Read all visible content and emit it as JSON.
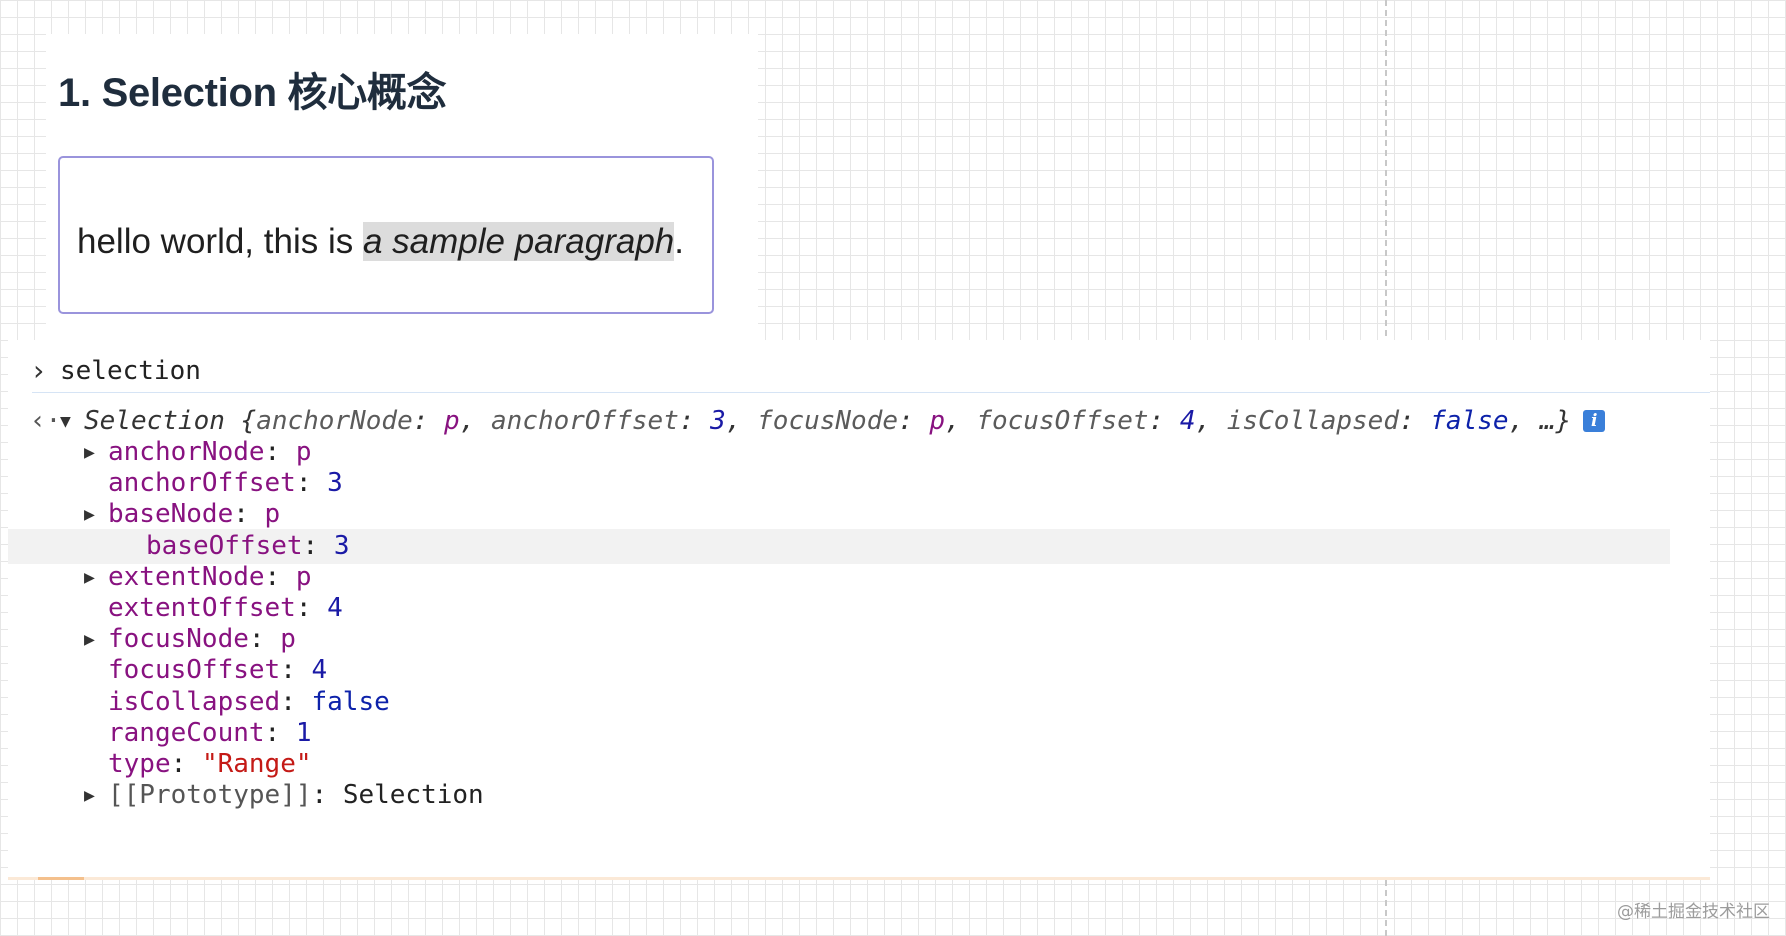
{
  "page": {
    "title": "1. Selection 核心概念",
    "paragraph": {
      "before": "hello world, this is ",
      "selected": "a sample paragraph",
      "after": "."
    }
  },
  "console": {
    "input": "selection",
    "summary": {
      "prefix": "Selection {",
      "anchorNode_key": "anchorNode",
      "anchorNode_val": "p",
      "anchorOffset_key": "anchorOffset",
      "anchorOffset_val": "3",
      "focusNode_key": "focusNode",
      "focusNode_val": "p",
      "focusOffset_key": "focusOffset",
      "focusOffset_val": "4",
      "isCollapsed_key": "isCollapsed",
      "isCollapsed_val": "false",
      "suffix": "…}"
    },
    "properties": [
      {
        "key": "anchorNode",
        "value": "p",
        "expandable": true,
        "type": "node"
      },
      {
        "key": "anchorOffset",
        "value": "3",
        "expandable": false,
        "type": "number"
      },
      {
        "key": "baseNode",
        "value": "p",
        "expandable": true,
        "type": "node"
      },
      {
        "key": "baseOffset",
        "value": "3",
        "expandable": false,
        "type": "number"
      },
      {
        "key": "extentNode",
        "value": "p",
        "expandable": true,
        "type": "node"
      },
      {
        "key": "extentOffset",
        "value": "4",
        "expandable": false,
        "type": "number"
      },
      {
        "key": "focusNode",
        "value": "p",
        "expandable": true,
        "type": "node"
      },
      {
        "key": "focusOffset",
        "value": "4",
        "expandable": false,
        "type": "number"
      },
      {
        "key": "isCollapsed",
        "value": "false",
        "expandable": false,
        "type": "boolean"
      },
      {
        "key": "rangeCount",
        "value": "1",
        "expandable": false,
        "type": "number"
      },
      {
        "key": "type",
        "value": "\"Range\"",
        "expandable": false,
        "type": "string"
      },
      {
        "key": "[[Prototype]]",
        "value": "Selection",
        "expandable": true,
        "type": "plain"
      }
    ],
    "hovered_row_key": "baseOffset"
  },
  "watermark": "@稀土掘金技术社区",
  "icons": {
    "prompt": "chevron-right-icon",
    "result": "back-arrow-icon",
    "expand": "triangle-right-icon",
    "collapse": "triangle-down-icon",
    "info": "info-icon"
  },
  "colors": {
    "editor_border": "#9a94dc",
    "selection_bg": "#dcdcdc",
    "key": "#881280",
    "number": "#1a1aa6",
    "string": "#c41a16"
  }
}
